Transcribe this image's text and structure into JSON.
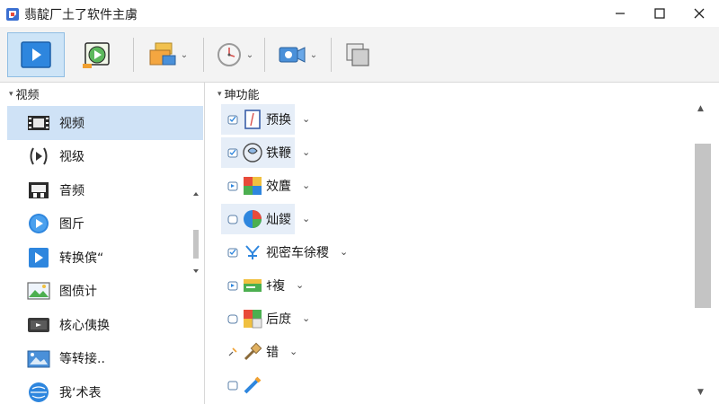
{
  "window": {
    "title": "翡靛厂土了软件主虜",
    "controls": {
      "minimize": "−",
      "maximize": "☐",
      "close": "✕"
    }
  },
  "toolbar": {
    "buttons": [
      {
        "icon": "play-icon",
        "active": true
      },
      {
        "icon": "video-play-icon",
        "active": false
      },
      {
        "icon": "folder-convert-icon",
        "has_dropdown": true,
        "dropdown_arrow": "⌄"
      },
      {
        "icon": "clock-icon",
        "has_dropdown": true,
        "dropdown_arrow": "⌄"
      },
      {
        "icon": "camera-icon",
        "has_dropdown": true,
        "dropdown_arrow": "⌄"
      },
      {
        "icon": "window-stack-icon",
        "has_dropdown": false
      }
    ]
  },
  "sidebar": {
    "header": "视频",
    "header_caret": "▾",
    "items": [
      {
        "label": "视频",
        "icon": "film-icon",
        "selected": true
      },
      {
        "label": "视级",
        "icon": "play-circle-outline-icon",
        "selected": false
      },
      {
        "label": "音频",
        "icon": "audio-film-icon",
        "selected": false
      },
      {
        "label": "图斤",
        "icon": "play-circle-icon",
        "selected": false
      },
      {
        "label": "转换傧“",
        "icon": "convert-play-icon",
        "selected": false
      },
      {
        "label": "图偾计",
        "icon": "image-icon",
        "selected": false
      },
      {
        "label": "核心侇换",
        "icon": "core-convert-icon",
        "selected": false
      },
      {
        "label": "等转接..",
        "icon": "image-convert-icon",
        "selected": false
      },
      {
        "label": "我‘术表",
        "icon": "globe-icon",
        "selected": false
      }
    ]
  },
  "functions": {
    "header": "功能",
    "header_prefix": "珅",
    "header_caret": "▾",
    "chevron": "⌄",
    "items": [
      {
        "label": "预换",
        "icon": "frame-icon",
        "highlighted": true
      },
      {
        "label": "铁鞭",
        "icon": "globe-brain-icon",
        "highlighted": true
      },
      {
        "label": "效麆",
        "icon": "palette-icon",
        "highlighted": false
      },
      {
        "label": "灿鑁",
        "icon": "color-globe-icon",
        "highlighted": true
      },
      {
        "label": "视密车徐稷",
        "icon": "text-effect-icon",
        "highlighted": false
      },
      {
        "label": "ｷ複",
        "icon": "caption-icon",
        "highlighted": false
      },
      {
        "label": "后庻",
        "icon": "grid-icon",
        "highlighted": false
      },
      {
        "label": "错",
        "icon": "tool-icon",
        "highlighted": false
      },
      {
        "label": "",
        "icon": "pencil-icon",
        "highlighted": false
      }
    ]
  },
  "colors": {
    "accent": "#2e86de",
    "selected_bg": "#cfe2f6",
    "hover_bg": "#e6eef8",
    "toolbar_bg": "#f3f3f3"
  }
}
